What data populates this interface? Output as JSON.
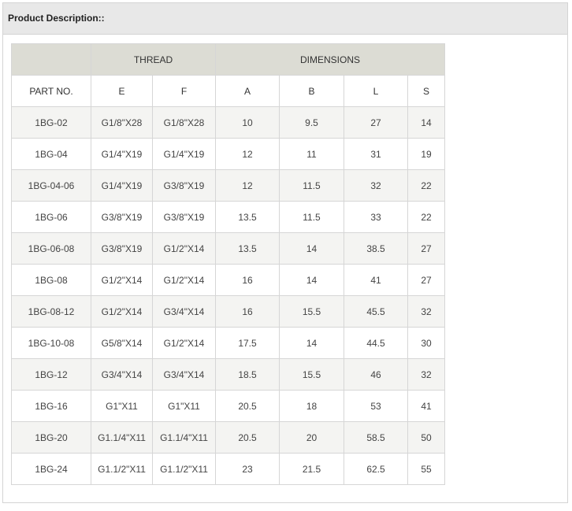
{
  "header": {
    "title": "Product Description::"
  },
  "table": {
    "groups": {
      "thread": "THREAD",
      "dimensions": "DIMENSIONS"
    },
    "columns": [
      "PART NO.",
      "E",
      "F",
      "A",
      "B",
      "L",
      "S"
    ],
    "rows": [
      [
        "1BG-02",
        "G1/8\"X28",
        "G1/8\"X28",
        "10",
        "9.5",
        "27",
        "14"
      ],
      [
        "1BG-04",
        "G1/4\"X19",
        "G1/4\"X19",
        "12",
        "11",
        "31",
        "19"
      ],
      [
        "1BG-04-06",
        "G1/4\"X19",
        "G3/8\"X19",
        "12",
        "11.5",
        "32",
        "22"
      ],
      [
        "1BG-06",
        "G3/8\"X19",
        "G3/8\"X19",
        "13.5",
        "11.5",
        "33",
        "22"
      ],
      [
        "1BG-06-08",
        "G3/8\"X19",
        "G1/2\"X14",
        "13.5",
        "14",
        "38.5",
        "27"
      ],
      [
        "1BG-08",
        "G1/2\"X14",
        "G1/2\"X14",
        "16",
        "14",
        "41",
        "27"
      ],
      [
        "1BG-08-12",
        "G1/2\"X14",
        "G3/4\"X14",
        "16",
        "15.5",
        "45.5",
        "32"
      ],
      [
        "1BG-10-08",
        "G5/8\"X14",
        "G1/2\"X14",
        "17.5",
        "14",
        "44.5",
        "30"
      ],
      [
        "1BG-12",
        "G3/4\"X14",
        "G3/4\"X14",
        "18.5",
        "15.5",
        "46",
        "32"
      ],
      [
        "1BG-16",
        "G1\"X11",
        "G1\"X11",
        "20.5",
        "18",
        "53",
        "41"
      ],
      [
        "1BG-20",
        "G1.1/4\"X11",
        "G1.1/4\"X11",
        "20.5",
        "20",
        "58.5",
        "50"
      ],
      [
        "1BG-24",
        "G1.1/2\"X11",
        "G1.1/2\"X11",
        "23",
        "21.5",
        "62.5",
        "55"
      ]
    ]
  },
  "colors": {
    "header_bg": "#e8e8e8",
    "group_header_bg": "#dcdcd4",
    "stripe_bg": "#f4f4f2",
    "border": "#d6d6d6"
  }
}
